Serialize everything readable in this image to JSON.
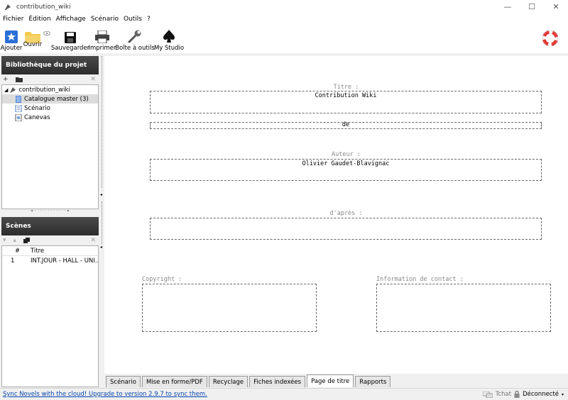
{
  "window": {
    "title": "contribution_wiki",
    "minimize": "—",
    "maximize": "☐",
    "close": "✕"
  },
  "menu": [
    "Fichier",
    "Édition",
    "Affichage",
    "Scénario",
    "Outils",
    "?"
  ],
  "toolbar": {
    "ajouter": "Ajouter",
    "ouvrir": "Ouvrir",
    "sauvegarder": "Sauvegarder",
    "imprimer": "Imprimer",
    "boite": "Boîte à outils",
    "studio": "My Studio"
  },
  "library": {
    "title": "Bibliothèque du projet",
    "root": "contribution_wiki",
    "items": [
      "Catalogue master (3)",
      "Scénario",
      "Canevas"
    ]
  },
  "scenes": {
    "title": "Scènes",
    "col_num": "#",
    "col_title": "Titre",
    "rows": [
      {
        "num": "1",
        "title": "INT.JOUR - HALL - UNI..."
      }
    ]
  },
  "title_page": {
    "titre_label": "Titre :",
    "titre_value": "Contribution Wiki",
    "de_value": "de",
    "auteur_label": "Auteur :",
    "auteur_value": "Olivier Gaudet-Blavignac",
    "dapres_label": "d'après :",
    "dapres_value": "",
    "copyright_label": "Copyright :",
    "contact_label": "Information de contact :"
  },
  "tabs": [
    "Scénario",
    "Mise en forme/PDF",
    "Recyclage",
    "Fiches indexées",
    "Page de titre",
    "Rapports"
  ],
  "active_tab": "Page de titre",
  "status": {
    "sync_link": "Sync Novels with the cloud! Upgrade to version 2.9.7 to sync them.",
    "chat": "Tchat",
    "connection": "Déconnecté"
  }
}
